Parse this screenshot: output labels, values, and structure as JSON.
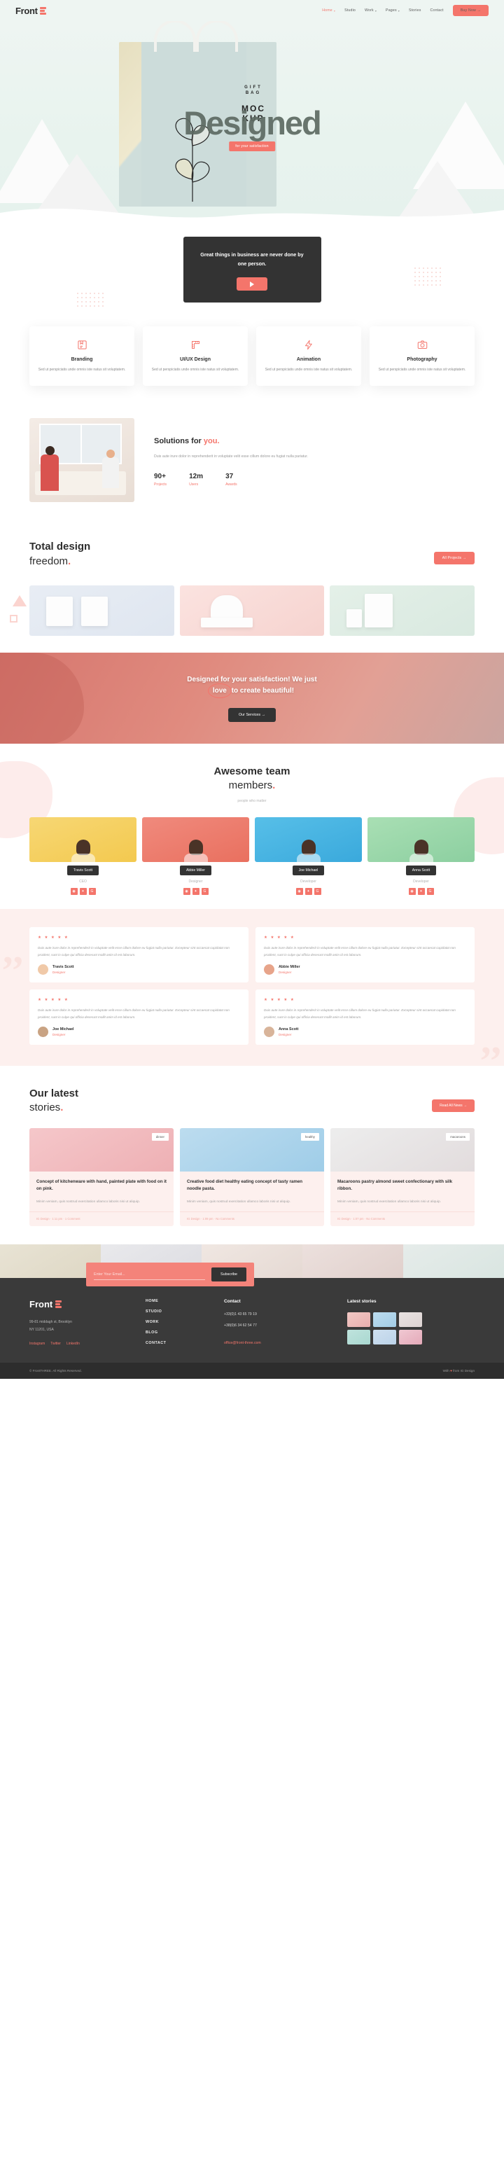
{
  "nav": {
    "brand": "Front",
    "links": [
      {
        "label": "Home",
        "caret": true,
        "active": true
      },
      {
        "label": "Studio",
        "caret": false,
        "active": false
      },
      {
        "label": "Work",
        "caret": true,
        "active": false
      },
      {
        "label": "Pages",
        "caret": true,
        "active": false
      },
      {
        "label": "Stories",
        "caret": false,
        "active": false
      },
      {
        "label": "Contact",
        "caret": false,
        "active": false
      }
    ],
    "cta": "Buy Now  →"
  },
  "hero": {
    "title": "Designed",
    "badge": "for your satisfaction",
    "bag_line1": "GIFT",
    "bag_line2": "BAG",
    "bag_line3": "MOC",
    "bag_line4": "KUP"
  },
  "quote": {
    "text": "Great things in business are never done by one person.",
    "play_icon": "play-icon"
  },
  "services": [
    {
      "icon": "branding-icon",
      "title": "Branding",
      "desc": "Sed ut perspiciatis unde omnis iste natus sit voluptatem."
    },
    {
      "icon": "ruler-icon",
      "title": "UI/UX Design",
      "desc": "Sed ut perspiciatis unde omnis iste natus sit voluptatem."
    },
    {
      "icon": "bolt-icon",
      "title": "Animation",
      "desc": "Sed ut perspiciatis unde omnis iste natus sit voluptatem."
    },
    {
      "icon": "camera-icon",
      "title": "Photography",
      "desc": "Sed ut perspiciatis unde omnis iste natus sit voluptatem."
    }
  ],
  "solutions": {
    "title_a": "Solutions for ",
    "title_b": "you.",
    "paragraph": "Duis aute irure dolor in reprehenderit in voluptate velit esse cillum dolore eu fugiat nulla pariatur.",
    "stats": [
      {
        "number": "90+",
        "label": "Projects"
      },
      {
        "number": "12m",
        "label": "Users"
      },
      {
        "number": "37",
        "label": "Awards"
      }
    ]
  },
  "freedom": {
    "line1": "Total design",
    "line2": "freedom",
    "dot": ".",
    "button": "All Projects  →"
  },
  "cta_banner": {
    "line1_a": "Designed for your satisfaction! We just",
    "line2_circle": "love",
    "line2_rest": " to create beautiful!",
    "button": "Our Services  →"
  },
  "team": {
    "title_line1": "Awesome team",
    "title_line2": "members",
    "dot": ".",
    "subtitle": "people who matter",
    "members": [
      {
        "name": "Travis Scott",
        "role": "CEO",
        "socials": [
          "dribbble-icon",
          "twitter-icon",
          "google-icon"
        ]
      },
      {
        "name": "Abbie Miller",
        "role": "Designer",
        "socials": [
          "dribbble-icon",
          "twitter-icon",
          "google-icon"
        ]
      },
      {
        "name": "Joe Michael",
        "role": "Developer",
        "socials": [
          "dribbble-icon",
          "twitter-icon",
          "google-icon"
        ]
      },
      {
        "name": "Anna Scott",
        "role": "Developer",
        "socials": [
          "dribbble-icon",
          "twitter-icon",
          "google-icon"
        ]
      }
    ]
  },
  "testimonials": [
    {
      "stars": "★ ★ ★ ★ ★",
      "text": "Duis aute irure dolor in reprehenderit in voluptate velit esse cillum dolore eu fugiat nulla pariatur. Excepteur sint occaecat cupidatat non proident, sunt in culpe qui officia deserunt mollit anim id est laborum.",
      "name": "Travis Scott",
      "role": "Designer"
    },
    {
      "stars": "★ ★ ★ ★ ★",
      "text": "Duis aute irure dolor in reprehenderit in voluptate velit esse cillum dolore eu fugiat nulla pariatur. Excepteur sint occaecat cupidatat non proident, sunt in culpe qui officia deserunt mollit anim id est laborum.",
      "name": "Abbie Miller",
      "role": "Designer"
    },
    {
      "stars": "★ ★ ★ ★ ★",
      "text": "Duis aute irure dolor in reprehenderit in voluptate velit esse cillum dolore eu fugiat nulla pariatur. Excepteur sint occaecat cupidatat non proident, sunt in culpe qui officia deserunt mollit anim id est laborum.",
      "name": "Joe Michael",
      "role": "Designer"
    },
    {
      "stars": "★ ★ ★ ★ ★",
      "text": "Duis aute irure dolor in reprehenderit in voluptate velit esse cillum dolore eu fugiat nulla pariatur. Excepteur sint occaecat cupidatat non proident, sunt in culpe qui officia deserunt mollit anim id est laborum.",
      "name": "Anna Scott",
      "role": "Designer"
    }
  ],
  "stories": {
    "title_line1": "Our latest",
    "title_line2": "stories",
    "dot": ".",
    "button": "Read All News  →",
    "posts": [
      {
        "tag": "dinner",
        "title": "Concept of kitchenware with hand, painted plate with food on it on pink.",
        "excerpt": "Minim veniam, quis nostrud exercitation ullamco laboris nisi ut aliquip.",
        "meta": "IG Design  ·  1:11 pm  ·  1 Comment"
      },
      {
        "tag": "healthy",
        "title": "Creative food diet healthy eating concept of tasty ramen noodle pasta.",
        "excerpt": "Minim veniam, quis nostrud exercitation ullamco laboris nisi ut aliquip.",
        "meta": "IG Design  ·  1:09 pm  ·  No Comments"
      },
      {
        "tag": "macaroons",
        "title": "Macaroons pastry almond sweet confectionary with silk ribbon.",
        "excerpt": "Minim veniam, quis nostrud exercitation ullamco laboris nisi ut aliquip.",
        "meta": "IG Design  ·  1:07 pm  ·  No Comments"
      }
    ]
  },
  "newsletter": {
    "placeholder": "Enter Your Email...",
    "value": "",
    "button": "Subscribe"
  },
  "footer": {
    "brand": "Front",
    "address_line1": "99-81 middagh st, Brooklyn",
    "address_line2": "NY 11201, USA",
    "socials": [
      {
        "label": "Instagram"
      },
      {
        "label": "Twitter"
      },
      {
        "label": "LinkedIn"
      }
    ],
    "nav": [
      {
        "label": "HOME"
      },
      {
        "label": "STUDIO"
      },
      {
        "label": "WORK"
      },
      {
        "label": "BLOG"
      },
      {
        "label": "CONTACT"
      }
    ],
    "contact_heading": "Contact",
    "phone1": "+33(0)1 43 65 79 19",
    "phone2": "+38(0)6 34 62 54 77",
    "email": "office@front-three.com",
    "stories_heading": "Latest stories",
    "copyright": "© FrontTHREE. All Rights Reserved.",
    "made_with_a": "With ",
    "made_with_heart": "♥",
    "made_with_b": " from IG Design"
  },
  "colors": {
    "accent": "#f4756b",
    "dark": "#333333",
    "mint": "#eef5f2",
    "blush": "#fdf0ee"
  }
}
